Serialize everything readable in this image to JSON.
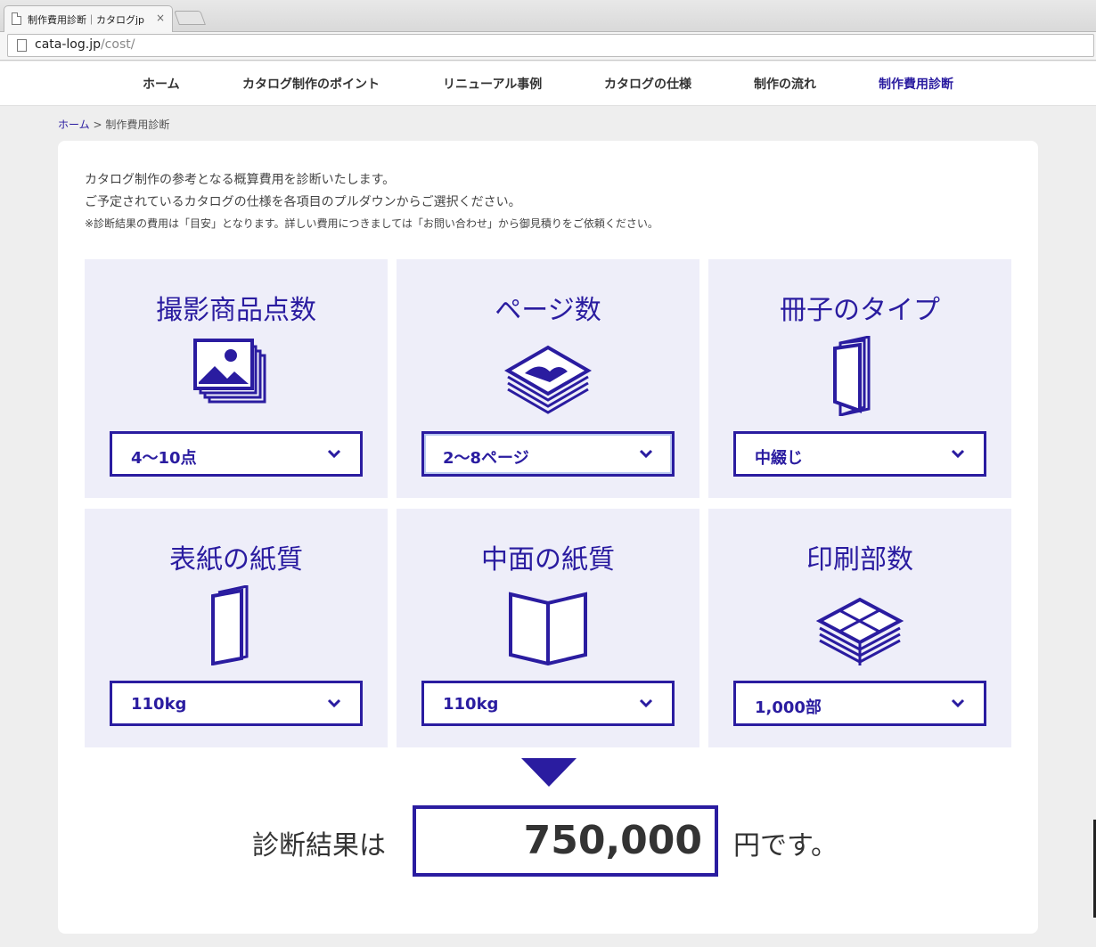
{
  "browser": {
    "tab_title": "制作費用診断｜カタログjp",
    "tab_close": "×",
    "url_host": "cata-log.jp",
    "url_path": "/cost/"
  },
  "nav": {
    "items": [
      "ホーム",
      "カタログ制作のポイント",
      "リニューアル事例",
      "カタログの仕様",
      "制作の流れ",
      "制作費用診断"
    ],
    "active_index": 5
  },
  "breadcrumb": {
    "home": "ホーム",
    "sep": " > ",
    "current": "制作費用診断"
  },
  "intro": {
    "line1": "カタログ制作の参考となる概算費用を診断いたします。",
    "line2": "ご予定されているカタログの仕様を各項目のプルダウンからご選択ください。",
    "line3": "※診断結果の費用は「目安」となります。詳しい費用につきましては「お問い合わせ」から御見積りをご依頼ください。"
  },
  "panels": [
    {
      "title": "撮影商品点数",
      "icon": "photos-icon",
      "value": "4〜10点"
    },
    {
      "title": "ページ数",
      "icon": "pages-stack-icon",
      "value": "2〜8ページ"
    },
    {
      "title": "冊子のタイプ",
      "icon": "booklet-icon",
      "value": "中綴じ"
    },
    {
      "title": "表紙の紙質",
      "icon": "cover-paper-icon",
      "value": "110kg"
    },
    {
      "title": "中面の紙質",
      "icon": "open-book-icon",
      "value": "110kg"
    },
    {
      "title": "印刷部数",
      "icon": "print-stack-icon",
      "value": "1,000部"
    }
  ],
  "result": {
    "label": "診断結果は",
    "value": "750,000",
    "unit": "円です。"
  },
  "colors": {
    "accent": "#2a1ca0",
    "panel_bg": "#eeeef9"
  }
}
